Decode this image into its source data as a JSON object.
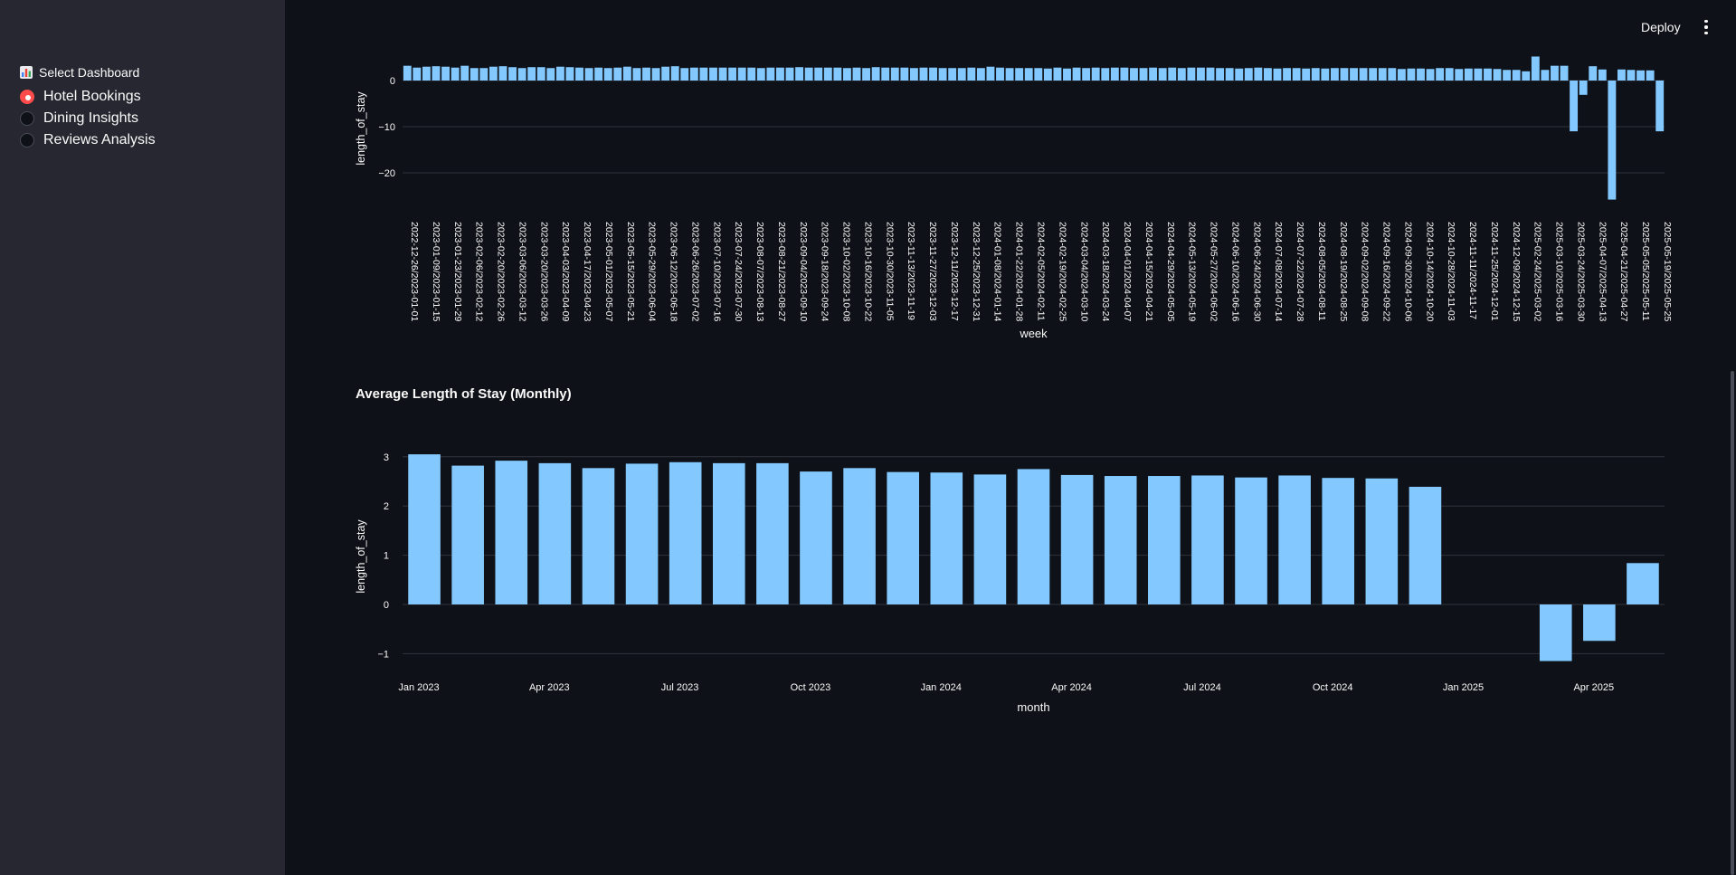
{
  "app": {
    "deploy_label": "Deploy",
    "menu_icon": "vertical-dots-icon",
    "accent_color": "#ff4b4b",
    "bar_color": "#83c9ff"
  },
  "sidebar": {
    "radio_label": "Select Dashboard",
    "radio_icon": "bar-chart-icon",
    "options": [
      "Hotel Bookings",
      "Dining Insights",
      "Reviews Analysis"
    ],
    "selected": "Hotel Bookings"
  },
  "chart_data": [
    {
      "type": "bar",
      "title": "",
      "xlabel": "week",
      "ylabel": "length_of_stay",
      "ylim": [
        -26,
        4
      ],
      "yticks": [
        0,
        -10,
        -20
      ],
      "grid": true,
      "x_tick_labels": [
        "2022-12-26/2023-01-01",
        "2023-01-09/2023-01-15",
        "2023-01-23/2023-01-29",
        "2023-02-06/2023-02-12",
        "2023-02-20/2023-02-26",
        "2023-03-06/2023-03-12",
        "2023-03-20/2023-03-26",
        "2023-04-03/2023-04-09",
        "2023-04-17/2023-04-23",
        "2023-05-01/2023-05-07",
        "2023-05-15/2023-05-21",
        "2023-05-29/2023-06-04",
        "2023-06-12/2023-06-18",
        "2023-06-26/2023-07-02",
        "2023-07-10/2023-07-16",
        "2023-07-24/2023-07-30",
        "2023-08-07/2023-08-13",
        "2023-08-21/2023-08-27",
        "2023-09-04/2023-09-10",
        "2023-09-18/2023-09-24",
        "2023-10-02/2023-10-08",
        "2023-10-16/2023-10-22",
        "2023-10-30/2023-11-05",
        "2023-11-13/2023-11-19",
        "2023-11-27/2023-12-03",
        "2023-12-11/2023-12-17",
        "2023-12-25/2023-12-31",
        "2024-01-08/2024-01-14",
        "2024-01-22/2024-01-28",
        "2024-02-05/2024-02-11",
        "2024-02-19/2024-02-25",
        "2024-03-04/2024-03-10",
        "2024-03-18/2024-03-24",
        "2024-04-01/2024-04-07",
        "2024-04-15/2024-04-21",
        "2024-04-29/2024-05-05",
        "2024-05-13/2024-05-19",
        "2024-05-27/2024-06-02",
        "2024-06-10/2024-06-16",
        "2024-06-24/2024-06-30",
        "2024-07-08/2024-07-14",
        "2024-07-22/2024-07-28",
        "2024-08-05/2024-08-11",
        "2024-08-19/2024-08-25",
        "2024-09-02/2024-09-08",
        "2024-09-16/2024-09-22",
        "2024-09-30/2024-10-06",
        "2024-10-14/2024-10-20",
        "2024-10-28/2024-11-03",
        "2024-11-11/2024-11-17",
        "2024-11-25/2024-12-01",
        "2024-12-09/2024-12-15",
        "2025-02-24/2025-03-02",
        "2025-03-10/2025-03-16",
        "2025-03-24/2025-03-30",
        "2025-04-07/2025-04-13",
        "2025-04-21/2025-04-27",
        "2025-05-05/2025-05-11",
        "2025-05-19/2025-05-25"
      ],
      "values": [
        3.2,
        2.8,
        3.0,
        3.1,
        3.0,
        2.8,
        3.2,
        2.7,
        2.7,
        3.0,
        3.1,
        2.9,
        2.7,
        2.9,
        2.9,
        2.7,
        3.0,
        2.9,
        2.8,
        2.7,
        2.8,
        2.7,
        2.8,
        3.0,
        2.7,
        2.8,
        2.7,
        3.0,
        3.1,
        2.7,
        2.8,
        2.8,
        2.8,
        2.8,
        2.8,
        2.8,
        2.8,
        2.7,
        2.8,
        2.8,
        2.8,
        2.9,
        2.8,
        2.8,
        2.8,
        2.8,
        2.7,
        2.8,
        2.7,
        2.9,
        2.8,
        2.8,
        2.8,
        2.7,
        2.8,
        2.8,
        2.7,
        2.7,
        2.7,
        2.8,
        2.7,
        3.0,
        2.8,
        2.7,
        2.7,
        2.7,
        2.7,
        2.6,
        2.8,
        2.6,
        2.8,
        2.7,
        2.8,
        2.7,
        2.8,
        2.8,
        2.7,
        2.7,
        2.8,
        2.7,
        2.8,
        2.7,
        2.8,
        2.8,
        2.8,
        2.7,
        2.7,
        2.6,
        2.7,
        2.8,
        2.7,
        2.6,
        2.7,
        2.7,
        2.6,
        2.7,
        2.6,
        2.7,
        2.7,
        2.7,
        2.7,
        2.7,
        2.7,
        2.7,
        2.5,
        2.6,
        2.6,
        2.5,
        2.7,
        2.7,
        2.5,
        2.6,
        2.6,
        2.6,
        2.5,
        2.3,
        2.3,
        2.0,
        5.2,
        2.3,
        3.2,
        3.2,
        -11.0,
        -3.1,
        3.1,
        2.4,
        -25.8,
        2.4,
        2.3,
        2.2,
        2.2,
        -11.0
      ]
    },
    {
      "type": "bar",
      "title": "Average Length of Stay (Monthly)",
      "xlabel": "month",
      "ylabel": "length_of_stay",
      "ylim": [
        -1.25,
        3.1
      ],
      "yticks": [
        3,
        2,
        1,
        0,
        -1
      ],
      "grid": true,
      "categories": [
        "2023-01",
        "2023-02",
        "2023-03",
        "2023-04",
        "2023-05",
        "2023-06",
        "2023-07",
        "2023-08",
        "2023-09",
        "2023-10",
        "2023-11",
        "2023-12",
        "2024-01",
        "2024-02",
        "2024-03",
        "2024-04",
        "2024-05",
        "2024-06",
        "2024-07",
        "2024-08",
        "2024-09",
        "2024-10",
        "2024-11",
        "2024-12",
        "2025-01",
        "2025-02",
        "2025-03",
        "2025-04",
        "2025-05"
      ],
      "values": [
        3.05,
        2.82,
        2.92,
        2.87,
        2.77,
        2.86,
        2.89,
        2.87,
        2.87,
        2.7,
        2.77,
        2.69,
        2.68,
        2.64,
        2.75,
        2.63,
        2.61,
        2.61,
        2.62,
        2.58,
        2.62,
        2.57,
        2.56,
        2.39,
        null,
        null,
        -1.15,
        -0.74,
        0.84
      ],
      "x_tick_labels": [
        "Jan 2023",
        "Apr 2023",
        "Jul 2023",
        "Oct 2023",
        "Jan 2024",
        "Apr 2024",
        "Jul 2024",
        "Oct 2024",
        "Jan 2025",
        "Apr 2025"
      ]
    }
  ]
}
